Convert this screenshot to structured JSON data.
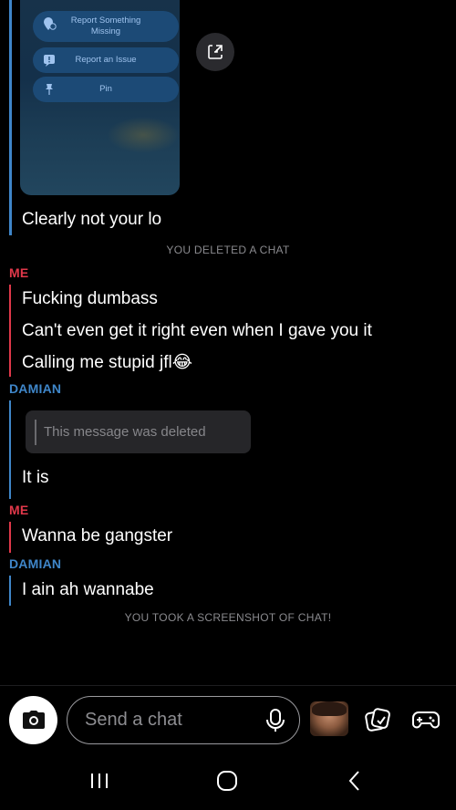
{
  "shared_media": {
    "menu": [
      {
        "label": "Report Something Missing",
        "icon": "map-pin-question-icon"
      },
      {
        "label": "Report an Issue",
        "icon": "alert-bubble-icon"
      },
      {
        "label": "Pin",
        "icon": "pin-icon"
      }
    ],
    "save_icon": "save-to-chat-icon"
  },
  "messages": [
    {
      "type": "text",
      "sender": "them",
      "text": "Clearly not your lo"
    },
    {
      "type": "system",
      "text": "YOU DELETED A CHAT"
    },
    {
      "type": "sender",
      "text": "ME"
    },
    {
      "type": "text",
      "sender": "me",
      "text": "Fucking dumbass"
    },
    {
      "type": "text",
      "sender": "me",
      "text": "Can't even get it right even when I gave you it"
    },
    {
      "type": "text",
      "sender": "me",
      "text": "Calling me stupid jfl😂"
    },
    {
      "type": "sender",
      "text": "DAMIAN"
    },
    {
      "type": "deleted",
      "text": "This message was deleted"
    },
    {
      "type": "text",
      "sender": "them",
      "text": "It is"
    },
    {
      "type": "sender",
      "text": "ME"
    },
    {
      "type": "text",
      "sender": "me",
      "text": "Wanna be gangster"
    },
    {
      "type": "sender",
      "text": "DAMIAN"
    },
    {
      "type": "text",
      "sender": "them",
      "text": "I ain ah wannabe"
    },
    {
      "type": "system",
      "text": "YOU TOOK A SCREENSHOT OF CHAT!"
    }
  ],
  "composer": {
    "placeholder": "Send a chat",
    "icons": [
      "camera-icon",
      "mic-icon",
      "bitmoji-avatar",
      "sticker-icon",
      "game-controller-icon"
    ]
  },
  "colors": {
    "me": "#e0384a",
    "them": "#3f86c9"
  },
  "nav": {
    "icons": [
      "recent-apps-icon",
      "home-icon",
      "back-icon"
    ]
  }
}
